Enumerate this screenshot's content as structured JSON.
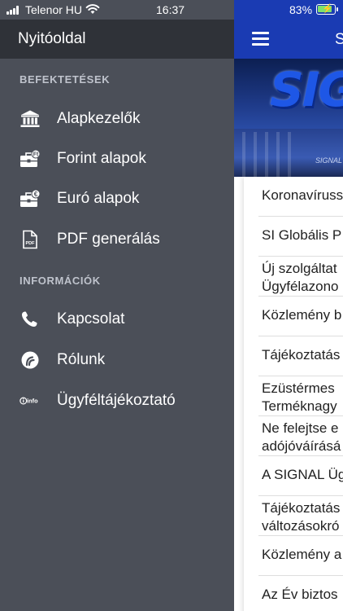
{
  "status_bar": {
    "carrier": "Telenor HU",
    "time": "16:37",
    "battery": "83%"
  },
  "drawer": {
    "home": "Nyitóoldal",
    "sections": [
      {
        "title": "BEFEKTETÉSEK",
        "items": [
          {
            "label": "Alapkezelők",
            "icon": "bank-icon"
          },
          {
            "label": "Forint alapok",
            "icon": "briefcase-forint-icon"
          },
          {
            "label": "Euró alapok",
            "icon": "briefcase-euro-icon"
          },
          {
            "label": "PDF generálás",
            "icon": "pdf-file-icon"
          }
        ]
      },
      {
        "title": "INFORMÁCIÓK",
        "items": [
          {
            "label": "Kapcsolat",
            "icon": "phone-icon"
          },
          {
            "label": "Rólunk",
            "icon": "signal-logo-icon"
          },
          {
            "label": "Ügyféltájékoztató",
            "icon": "info-icon"
          }
        ]
      }
    ]
  },
  "icons": {
    "pdf_text": "PDF",
    "info_text": "info"
  },
  "app": {
    "title": "S",
    "hero_sign": "SIG",
    "hero_caption": "SIGNAL",
    "news": [
      {
        "lines": [
          "Koronavíruss"
        ]
      },
      {
        "lines": [
          "SI Globális P"
        ]
      },
      {
        "lines": [
          "Új szolgáltat",
          "Ügyfélazono"
        ]
      },
      {
        "lines": [
          "Közlemény b"
        ]
      },
      {
        "lines": [
          "Tájékoztatás"
        ]
      },
      {
        "lines": [
          "Ezüstérmes",
          "Terméknagy"
        ]
      },
      {
        "lines": [
          "Ne felejtse e",
          "adójóváírásá"
        ]
      },
      {
        "lines": [
          "A SIGNAL Üg"
        ]
      },
      {
        "lines": [
          "Tájékoztatás",
          "változásokró"
        ]
      },
      {
        "lines": [
          "Közlemény a"
        ]
      },
      {
        "lines": [
          "Az Év biztos"
        ]
      }
    ]
  },
  "colors": {
    "drawer_bg": "#4b4f58",
    "drawer_header": "#2f3238",
    "nav_bar": "#1a3bb3"
  }
}
